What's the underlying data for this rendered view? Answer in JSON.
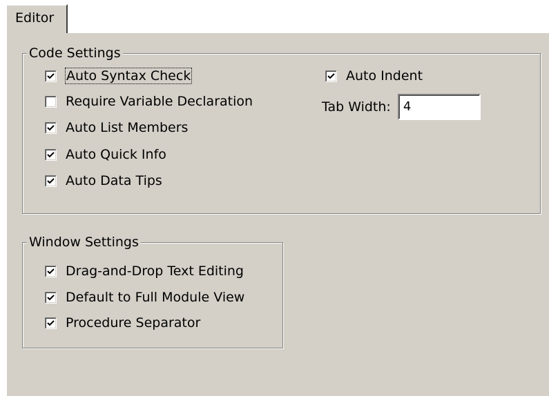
{
  "tab": {
    "label": "Editor"
  },
  "code_settings": {
    "title": "Code Settings",
    "options": [
      {
        "label": "Auto Syntax Check",
        "checked": true
      },
      {
        "label": "Require Variable Declaration",
        "checked": false
      },
      {
        "label": "Auto List Members",
        "checked": true
      },
      {
        "label": "Auto Quick Info",
        "checked": true
      },
      {
        "label": "Auto Data Tips",
        "checked": true
      }
    ],
    "auto_indent": {
      "label": "Auto Indent",
      "checked": true
    },
    "tab_width": {
      "label": "Tab Width:",
      "value": "4"
    }
  },
  "window_settings": {
    "title": "Window Settings",
    "options": [
      {
        "label": "Drag-and-Drop Text Editing",
        "checked": true
      },
      {
        "label": "Default to Full Module View",
        "checked": true
      },
      {
        "label": "Procedure Separator",
        "checked": true
      }
    ]
  },
  "colors": {
    "face": "#d4d0c8",
    "highlight": "#ffffff",
    "shadow": "#808080",
    "dark_shadow": "#404040"
  }
}
